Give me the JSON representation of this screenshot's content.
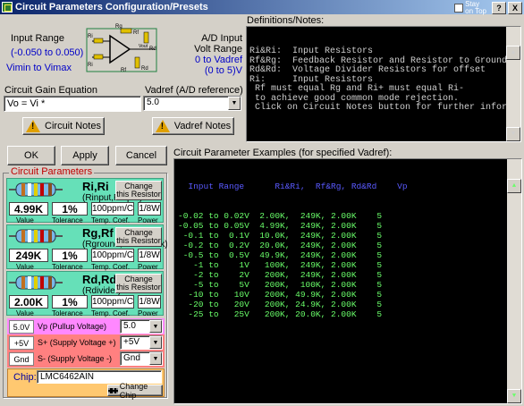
{
  "window": {
    "title": "Circuit Parameters Configuration/Presets",
    "stay_on_top": "Stay\non Top",
    "help_btn": "?",
    "close_btn": "X"
  },
  "input_range": {
    "label": "Input Range",
    "value": "(-0.050 to 0.050)",
    "sub": "Vimin to Vimax"
  },
  "ad_input": {
    "label1": "A/D Input",
    "label2": "Volt Range",
    "line3": "0 to Vadref",
    "line4": "(0 to 5)V"
  },
  "diagram": {
    "labels": [
      "Rg",
      "Rf",
      "Ri",
      "Vout",
      "Rd",
      "Rd",
      "Ri",
      "Rf"
    ]
  },
  "gain": {
    "label": "Circuit Gain Equation",
    "value": "Vo = Vi *"
  },
  "vadref": {
    "label": "Vadref (A/D reference)",
    "value": "5.0"
  },
  "buttons": {
    "circuit_notes": "Circuit Notes",
    "vadref_notes": "Vadref Notes",
    "ok": "OK",
    "apply": "Apply",
    "cancel": "Cancel",
    "change_chip": "Change Chip"
  },
  "definitions": {
    "label": "Definitions/Notes:",
    "lines": [
      "Ri&Ri:  Input Resistors",
      "Rf&Rg:  Feedback Resistor and Resistor to Ground",
      "Rd&Rd:  Voltage Divider Resistors for offset",
      "Ri:     Input Resistors",
      " Rf must equal Rg and Ri+ must equal Ri-",
      " to achieve good common mode rejection.",
      " Click on Circuit Notes button for further information."
    ]
  },
  "params_group": {
    "label": "Circuit Parameters"
  },
  "resistors": [
    {
      "name": "Ri,Ri",
      "sub": "(Rinput,Rinput)",
      "change": "Change\nthis Resistor",
      "value": "4.99K",
      "tolerance": "1%",
      "temp": "100ppm/C",
      "power": "1/8W",
      "cap_value": "Value",
      "cap_tol": "Tolerance",
      "cap_temp": "Temp. Coef.",
      "cap_power": "Power"
    },
    {
      "name": "Rg,Rf",
      "sub": "(Rground,Rfeedback)",
      "change": "Change\nthis Resistor",
      "value": "249K",
      "tolerance": "1%",
      "temp": "100ppm/C",
      "power": "1/8W",
      "cap_value": "Value",
      "cap_tol": "Tolerance",
      "cap_temp": "Temp. Coef.",
      "cap_power": "Power"
    },
    {
      "name": "Rd,Rd",
      "sub": "(Rdivider)",
      "change": "Change\nthis Resistor",
      "value": "2.00K",
      "tolerance": "1%",
      "temp": "100ppm/C",
      "power": "1/8W",
      "cap_value": "Value",
      "cap_tol": "Tolerance",
      "cap_temp": "Temp. Coef.",
      "cap_power": "Power"
    }
  ],
  "supplies": [
    {
      "tag": "5.0V",
      "label": "Vp (Pullup Voltage)",
      "value": "5.0",
      "color": "#ff88ff"
    },
    {
      "tag": "+5V",
      "label": "S+ (Supply Voltage +)",
      "value": "+5V",
      "color": "#ff8080"
    },
    {
      "tag": "Gnd",
      "label": "S-  (Supply Voltage -)",
      "value": "Gnd",
      "color": "#ff8080"
    }
  ],
  "chip": {
    "label": "Chip:",
    "value": "LMC6462AIN"
  },
  "examples": {
    "label": "Circuit Parameter Examples (for specified Vadref):",
    "header": "  Input Range      Ri&Ri,  Rf&Rg, Rd&Rd    Vp",
    "rows": [
      "-0.02 to 0.02V  2.00K,  249K, 2.00K    5",
      "-0.05 to 0.05V  4.99K,  249K, 2.00K    5",
      " -0.1 to  0.1V  10.0K,  249K, 2.00K    5",
      " -0.2 to  0.2V  20.0K,  249K, 2.00K    5",
      " -0.5 to  0.5V  49.9K,  249K, 2.00K    5",
      "   -1 to    1V   100K,  249K, 2.00K    5",
      "   -2 to    2V   200K,  249K, 2.00K    5",
      "   -5 to    5V   200K,  100K, 2.00K    5",
      "  -10 to   10V   200K, 49.9K, 2.00K    5",
      "  -20 to   20V   200K, 24.9K, 2.00K    5",
      "  -25 to   25V   200K, 20.0K, 2.00K    5"
    ]
  }
}
